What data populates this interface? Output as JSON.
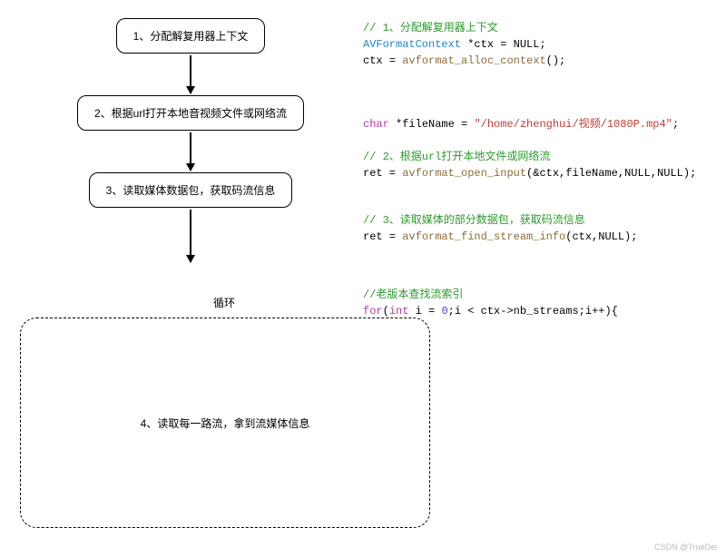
{
  "flow": {
    "step1": "1、分配解复用器上下文",
    "step2": "2、根据url打开本地音视频文件或网络流",
    "step3": "3、读取媒体数据包，获取码流信息",
    "loopLabel": "循环",
    "step4": "4、读取每一路流，拿到流媒体信息"
  },
  "code1": {
    "comment": "// 1、分配解复用器上下文",
    "type": "AVFormatContext",
    "line2rest": " *ctx = NULL;",
    "line3a": "ctx = ",
    "line3func": "avformat_alloc_context",
    "line3b": "();"
  },
  "code2": {
    "kw1": "char",
    "line1mid": " *fileName = ",
    "str": "\"/home/zhenghui/视频/1080P.mp4\"",
    "line1end": ";",
    "comment": "// 2、根据url打开本地文件或网络流",
    "line3a": "ret = ",
    "func": "avformat_open_input",
    "line3b": "(&ctx,fileName,NULL,NULL);"
  },
  "code3": {
    "comment": "// 3、读取媒体的部分数据包，获取码流信息",
    "line2a": "ret = ",
    "func": "avformat_find_stream_info",
    "line2b": "(ctx,NULL);"
  },
  "code4": {
    "comment": "//老版本查找流索引",
    "kwfor": "for",
    "paren1": "(",
    "kwint": "int",
    "seg1": " i = ",
    "zero": "0",
    "seg2": ";i < ctx->nb_streams;i++){"
  },
  "watermark": "CSDN @TrueDei"
}
